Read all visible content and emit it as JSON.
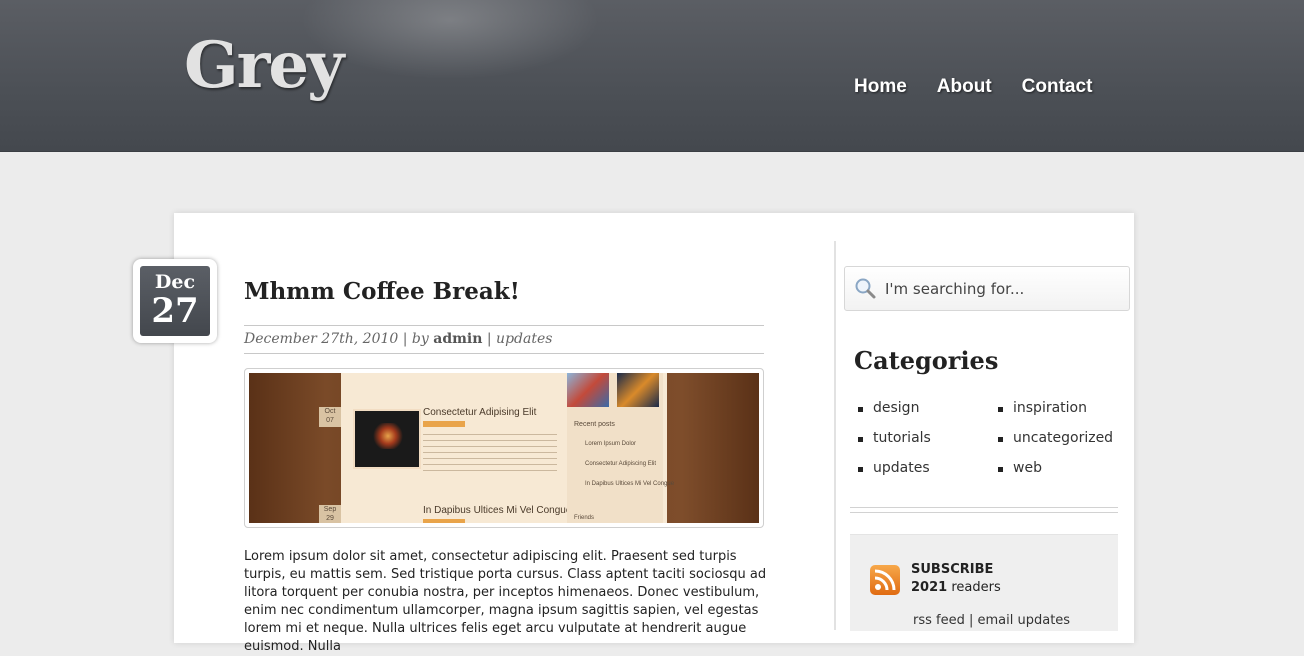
{
  "site": {
    "logo": "Grey"
  },
  "nav": {
    "items": [
      "Home",
      "About",
      "Contact"
    ]
  },
  "post": {
    "date_month": "Dec",
    "date_day": "27",
    "title": "Mhmm Coffee Break!",
    "date": "December 27th, 2010",
    "by": "by",
    "author": "admin",
    "category": "updates",
    "body": "Lorem ipsum dolor sit amet, consectetur adipiscing elit. Praesent sed turpis turpis, eu mattis sem. Sed tristique porta cursus. Class aptent taciti sociosqu ad litora torquent per conubia nostra, per inceptos himenaeos. Donec vestibulum, enim nec condimentum ullamcorper, magna ipsum sagittis sapien, vel egestas lorem mi et neque. Nulla ultrices felis eget arcu vulputate at hendrerit augue euismod. Nulla"
  },
  "thumbnail": {
    "post1_title": "Consectetur Adipising Elit",
    "post2_title": "In Dapibus Ultices Mi Vel Congue",
    "recent_posts": "Recent posts",
    "recent": [
      "Lorem Ipsum Dolor",
      "Consectetur Adipiscing Elit",
      "In Dapibus Ultices Mi Vel Congue"
    ],
    "friends": "Friends",
    "date1_month": "Oct",
    "date1_day": "07",
    "date2_month": "Sep",
    "date2_day": "29"
  },
  "search": {
    "placeholder": "I'm searching for..."
  },
  "categories": {
    "title": "Categories",
    "items": [
      "design",
      "inspiration",
      "tutorials",
      "uncategorized",
      "updates",
      "web"
    ]
  },
  "subscribe": {
    "title": "SUBSCRIBE",
    "count": "2021",
    "readers": "readers",
    "rss_link": "rss feed",
    "email_link": "email updates"
  }
}
